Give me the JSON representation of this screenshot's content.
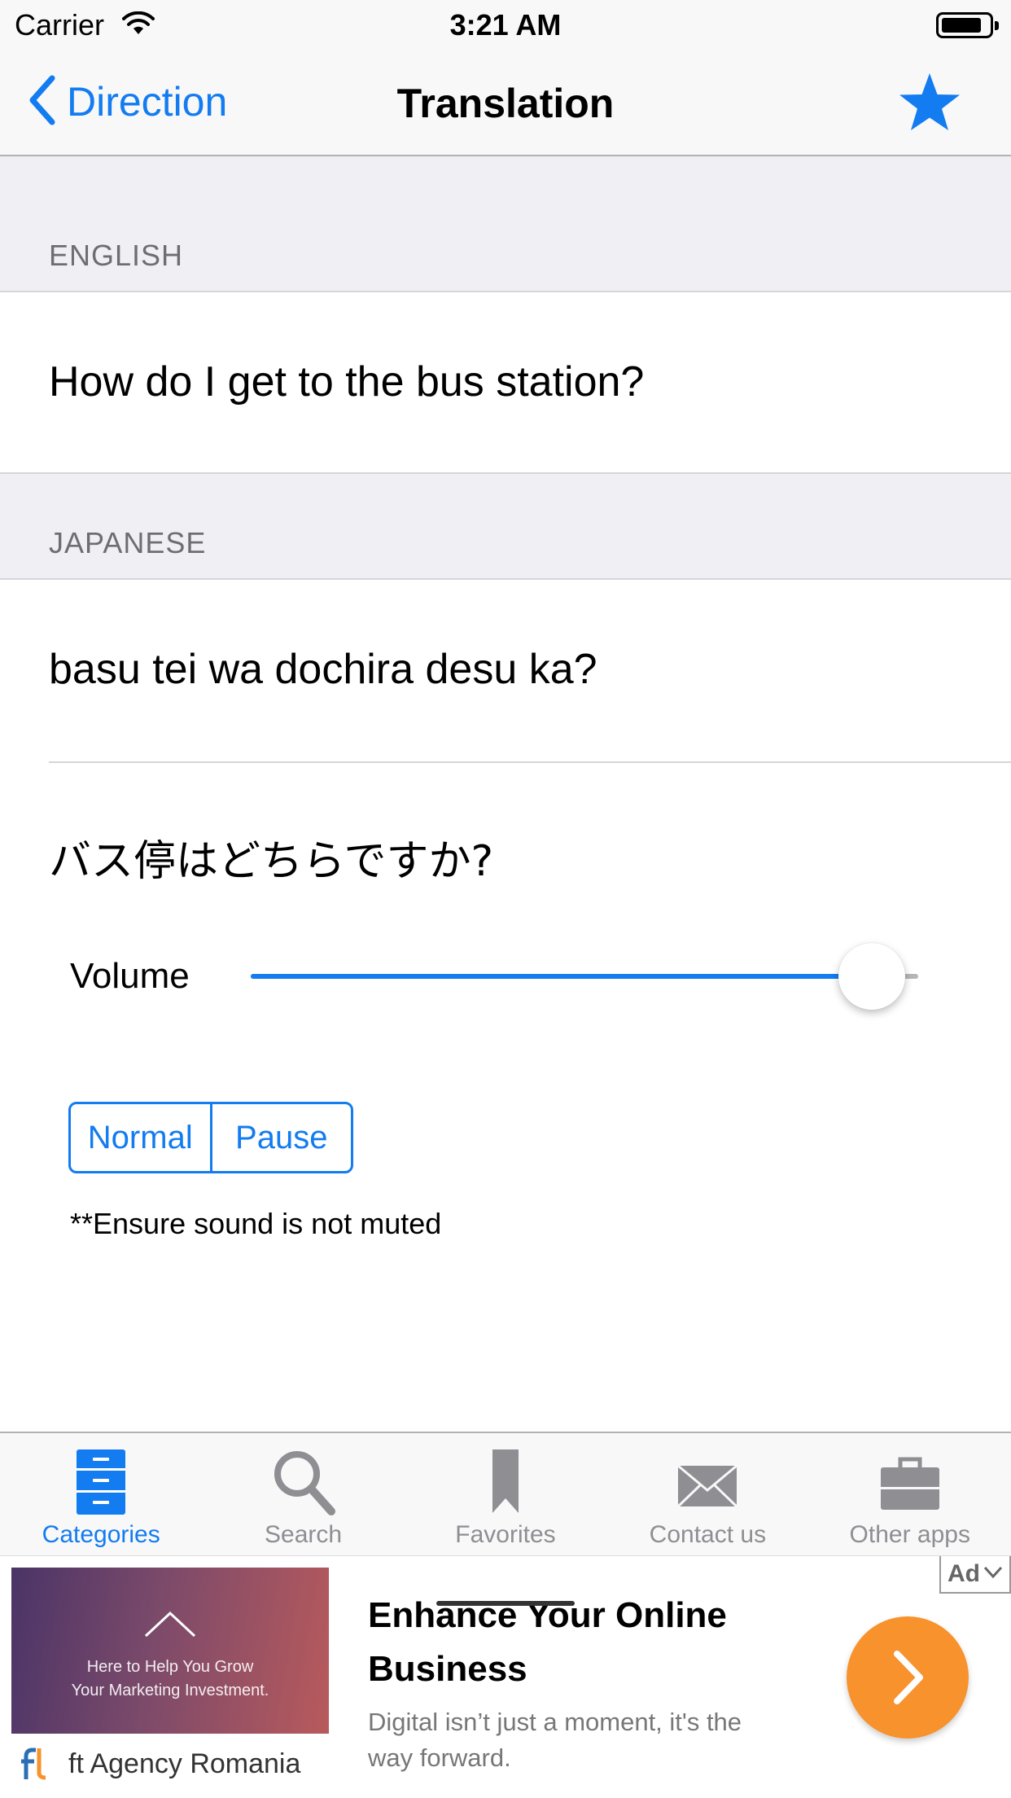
{
  "status_bar": {
    "carrier": "Carrier",
    "time": "3:21 AM"
  },
  "nav": {
    "back_label": "Direction",
    "title": "Translation",
    "favorite_icon": "star-icon",
    "accent_color": "#127cf0"
  },
  "sections": {
    "english": {
      "header": "ENGLISH",
      "text": "How do I get to the bus station?"
    },
    "japanese": {
      "header": "JAPANESE",
      "romaji": "basu tei wa dochira desu ka?",
      "native": "バス停はどちらですか?"
    }
  },
  "volume": {
    "label": "Volume",
    "value": 0.93
  },
  "playback": {
    "segments": [
      "Normal",
      "Pause"
    ]
  },
  "note": "**Ensure sound is not muted",
  "tab_bar": {
    "items": [
      {
        "label": "Categories",
        "icon": "cabinet-icon",
        "active": true
      },
      {
        "label": "Search",
        "icon": "search-icon",
        "active": false
      },
      {
        "label": "Favorites",
        "icon": "bookmark-icon",
        "active": false
      },
      {
        "label": "Contact us",
        "icon": "envelope-icon",
        "active": false
      },
      {
        "label": "Other apps",
        "icon": "briefcase-icon",
        "active": false
      }
    ]
  },
  "ad": {
    "badge": "Ad",
    "image_text_line1": "Here to Help You Grow",
    "image_text_line2": "Your Marketing Investment.",
    "brand": "ft Agency Romania",
    "headline": "Enhance Your Online Business",
    "description": "Digital isn’t just a moment, it's the way forward.",
    "cta_color": "#f7922c"
  }
}
